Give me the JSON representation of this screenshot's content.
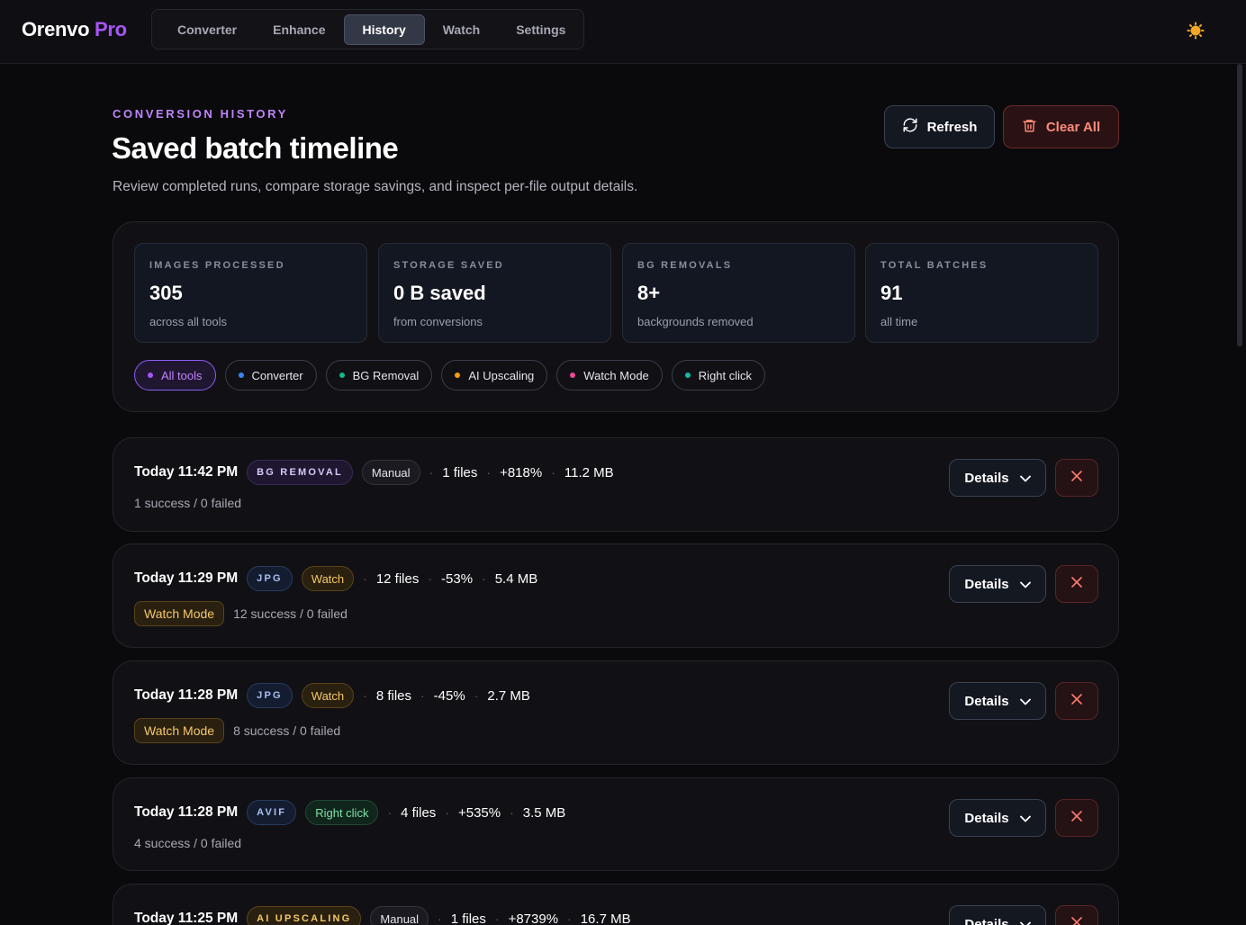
{
  "brand": {
    "name": "Orenvo",
    "suffix": "Pro"
  },
  "nav": {
    "tabs": [
      {
        "label": "Converter",
        "active": false
      },
      {
        "label": "Enhance",
        "active": false
      },
      {
        "label": "History",
        "active": true
      },
      {
        "label": "Watch",
        "active": false
      },
      {
        "label": "Settings",
        "active": false
      }
    ],
    "theme_icon": "sun-icon"
  },
  "header": {
    "eyebrow": "CONVERSION HISTORY",
    "title": "Saved batch timeline",
    "subtitle": "Review completed runs, compare storage savings, and inspect per-file output details.",
    "refresh_label": "Refresh",
    "clear_label": "Clear All"
  },
  "stats": [
    {
      "label": "IMAGES PROCESSED",
      "value": "305",
      "sub": "across all tools"
    },
    {
      "label": "STORAGE SAVED",
      "value": "0 B saved",
      "sub": "from conversions"
    },
    {
      "label": "BG REMOVALS",
      "value": "8+",
      "sub": "backgrounds removed"
    },
    {
      "label": "TOTAL BATCHES",
      "value": "91",
      "sub": "all time"
    }
  ],
  "filters": [
    {
      "label": "All tools",
      "color": "#a855f7",
      "active": true
    },
    {
      "label": "Converter",
      "color": "#3b82f6",
      "active": false
    },
    {
      "label": "BG Removal",
      "color": "#10b981",
      "active": false
    },
    {
      "label": "AI Upscaling",
      "color": "#f59e0b",
      "active": false
    },
    {
      "label": "Watch Mode",
      "color": "#ec4899",
      "active": false
    },
    {
      "label": "Right click",
      "color": "#14b8a6",
      "active": false
    }
  ],
  "rows": [
    {
      "time": "Today 11:42 PM",
      "format": "BG REMOVAL",
      "source": "Manual",
      "files": "1 files",
      "change": "+818%",
      "size": "11.2 MB",
      "mode": "",
      "result": "1 success / 0 failed"
    },
    {
      "time": "Today 11:29 PM",
      "format": "JPG",
      "source": "Watch",
      "files": "12 files",
      "change": "-53%",
      "size": "5.4 MB",
      "mode": "Watch Mode",
      "result": "12 success / 0 failed"
    },
    {
      "time": "Today 11:28 PM",
      "format": "JPG",
      "source": "Watch",
      "files": "8 files",
      "change": "-45%",
      "size": "2.7 MB",
      "mode": "Watch Mode",
      "result": "8 success / 0 failed"
    },
    {
      "time": "Today 11:28 PM",
      "format": "AVIF",
      "source": "Right click",
      "files": "4 files",
      "change": "+535%",
      "size": "3.5 MB",
      "mode": "",
      "result": "4 success / 0 failed"
    },
    {
      "time": "Today 11:25 PM",
      "format": "AI UPSCALING",
      "source": "Manual",
      "files": "1 files",
      "change": "+8739%",
      "size": "16.7 MB",
      "mode": "",
      "result": ""
    }
  ],
  "row_actions": {
    "details_label": "Details"
  }
}
